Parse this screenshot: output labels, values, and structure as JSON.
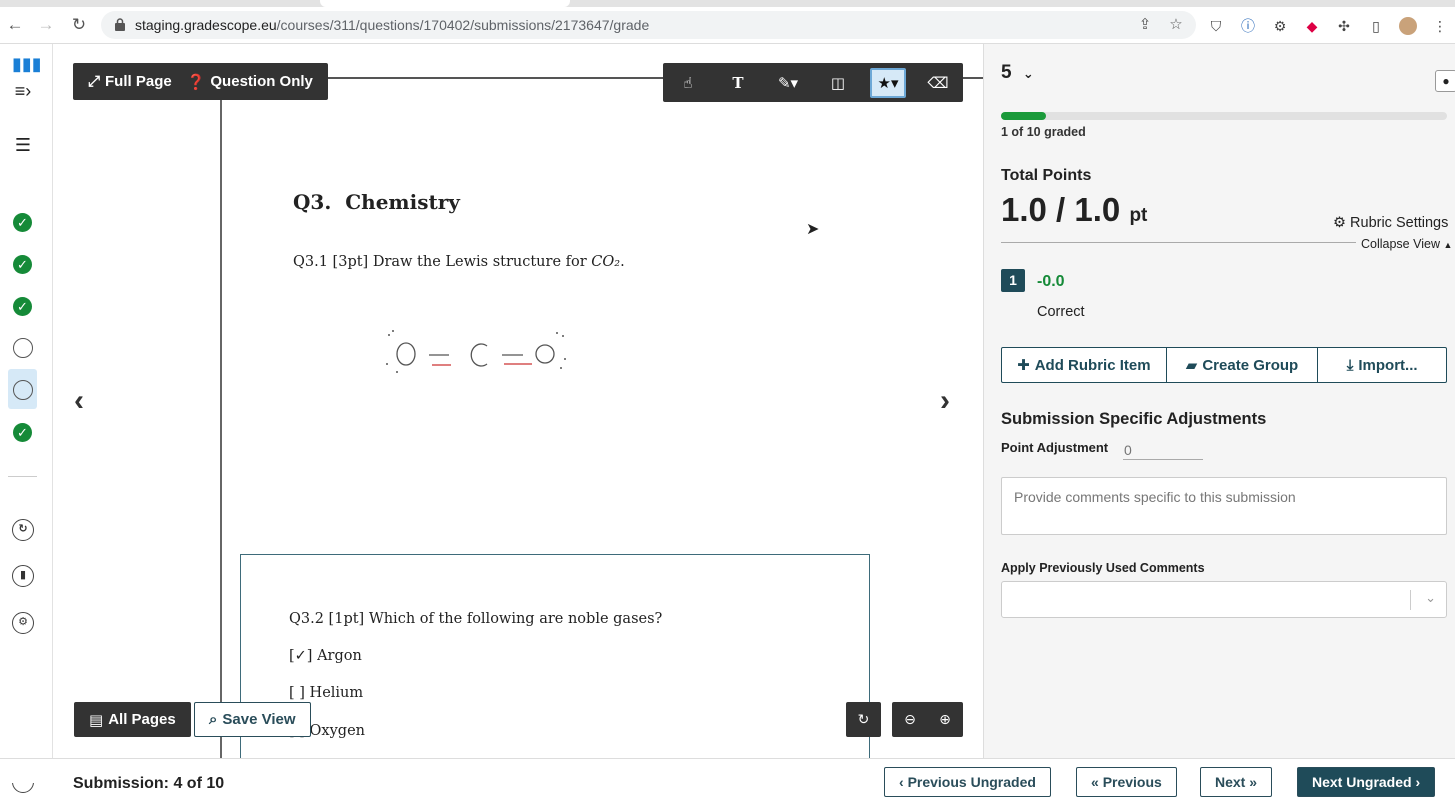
{
  "browser": {
    "url_host": "staging.gradescope.eu",
    "url_path": "/courses/311/questions/170402/submissions/2173647/grade"
  },
  "viewer": {
    "full_page_label": "Full Page",
    "question_only_label": "Question Only",
    "all_pages_label": "All Pages",
    "save_view_label": "Save View",
    "document": {
      "q3_title_num": "Q3.",
      "q3_title": "Chemistry",
      "q31_text": "Q3.1 [3pt] Draw the Lewis structure for",
      "q31_formula": "CO₂",
      "q32_text": "Q3.2 [1pt]  Which of the following are noble gases?",
      "options": [
        {
          "box": "[✓]",
          "label": "Argon"
        },
        {
          "box": "[ ]",
          "label": "Helium"
        },
        {
          "box": "[ ]",
          "label": "Oxygen"
        }
      ]
    }
  },
  "panel": {
    "question_number": "5",
    "graded_progress": 0.1,
    "graded_text": "1 of 10 graded",
    "total_points_label": "Total Points",
    "score": "1.0 / 1.0",
    "score_unit": "pt",
    "rubric_settings_label": "Rubric Settings",
    "collapse_view_label": "Collapse View",
    "rubric_items": [
      {
        "number": "1",
        "points": "-0.0",
        "description": "Correct"
      }
    ],
    "buttons": {
      "add_rubric": "Add Rubric Item",
      "create_group": "Create Group",
      "import": "Import..."
    },
    "adjustments_title": "Submission Specific Adjustments",
    "point_adjustment_label": "Point Adjustment",
    "point_adjustment_placeholder": "0",
    "comment_placeholder": "Provide comments specific to this submission",
    "prev_comments_label": "Apply Previously Used Comments"
  },
  "bottom": {
    "submission_info": "Submission: 4 of 10",
    "prev_ungraded": "Previous Ungraded",
    "previous": "Previous",
    "next": "Next",
    "next_ungraded": "Next Ungraded"
  },
  "colors": {
    "accent": "#1f4b59",
    "success": "#158a38",
    "toolbar": "#333333"
  }
}
